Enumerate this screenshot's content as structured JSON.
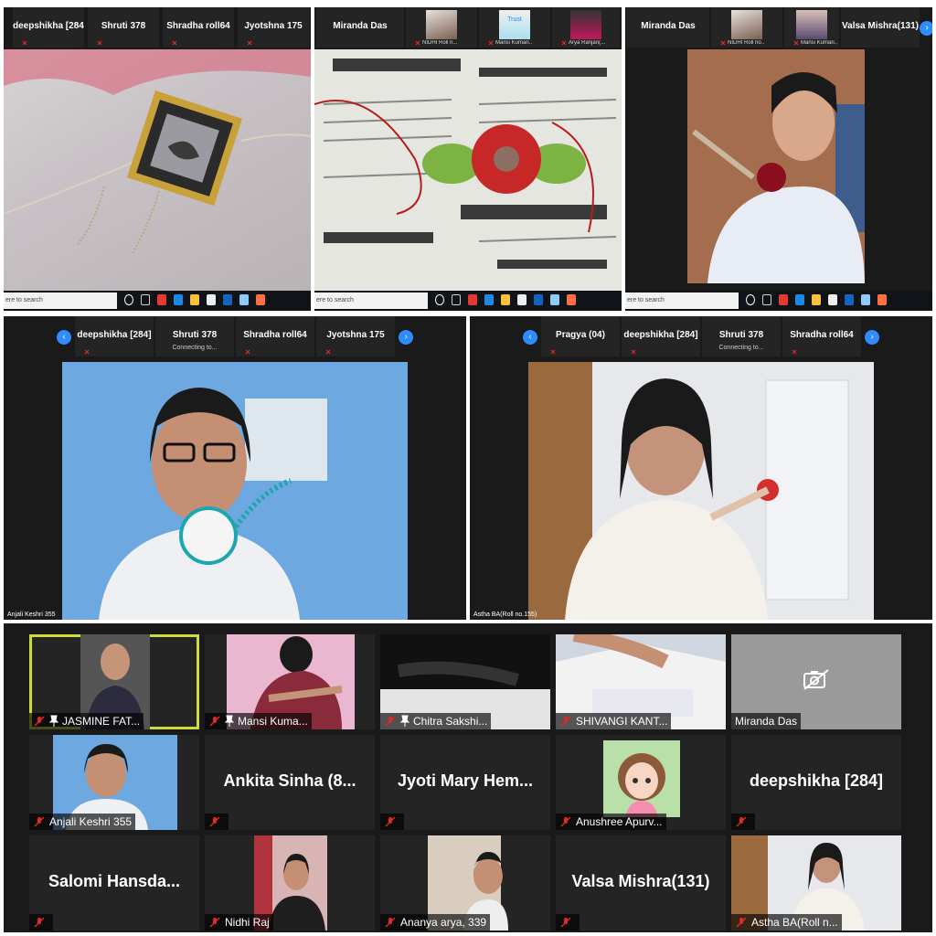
{
  "panels": {
    "p1": {
      "strip": [
        "deepshikha [284]",
        "Shruti 378",
        "Shradha roll64",
        "Jyotshna 175"
      ],
      "search": "ere to search"
    },
    "p2": {
      "strip": [
        "Miranda Das",
        "NIDHI Roll n...",
        "Mansi Kumari...",
        "Arya Ranjan(..."
      ],
      "thumb_text": "Trust",
      "search": "ere to search"
    },
    "p3": {
      "strip": [
        "Miranda Das",
        "NIDHI Roll no...",
        "Mansi Kumari...",
        "Valsa Mishra(131)"
      ],
      "search": "ere to search"
    },
    "p4": {
      "strip": [
        "deepshikha [284]",
        "Shruti 378",
        "Shradha roll64",
        "Jyotshna 175"
      ],
      "sub": "Connecting to...",
      "speaker": "Anjali Keshri 355"
    },
    "p5": {
      "strip": [
        "Pragya (04)",
        "deepshikha [284]",
        "Shruti 378",
        "Shradha roll64"
      ],
      "sub": "Connecting to...",
      "speaker": "Astha BA(Roll no.155)"
    }
  },
  "gallery": [
    {
      "name": "JASMINE FAT...",
      "pinned": true,
      "video": true
    },
    {
      "name": "Mansi Kuma...",
      "pinned": true,
      "video": true
    },
    {
      "name": "Chitra Sakshi...",
      "pinned": true,
      "video": true
    },
    {
      "name": "SHIVANGI KANT...",
      "video": true
    },
    {
      "name": "Miranda Das",
      "video": false,
      "camera_off": true
    },
    {
      "name": "Anjali Keshri 355",
      "video": true
    },
    {
      "big": "Ankita Sinha (8...",
      "video": false
    },
    {
      "big": "Jyoti Mary Hem...",
      "video": false
    },
    {
      "name": "Anushree Apurv...",
      "video": true
    },
    {
      "big": "deepshikha [284]",
      "video": false
    },
    {
      "big": "Salomi Hansda...",
      "video": false
    },
    {
      "name": "Nidhi Raj",
      "video": true
    },
    {
      "name": "Ananya arya, 339",
      "video": true
    },
    {
      "big": "Valsa Mishra(131)",
      "video": false
    },
    {
      "name": "Astha BA(Roll n...",
      "video": true
    }
  ],
  "colors": {
    "zoom_blue": "#2d8cff",
    "mute_red": "#e02828",
    "active_speaker": "#cddc39",
    "tile": "#242424"
  }
}
